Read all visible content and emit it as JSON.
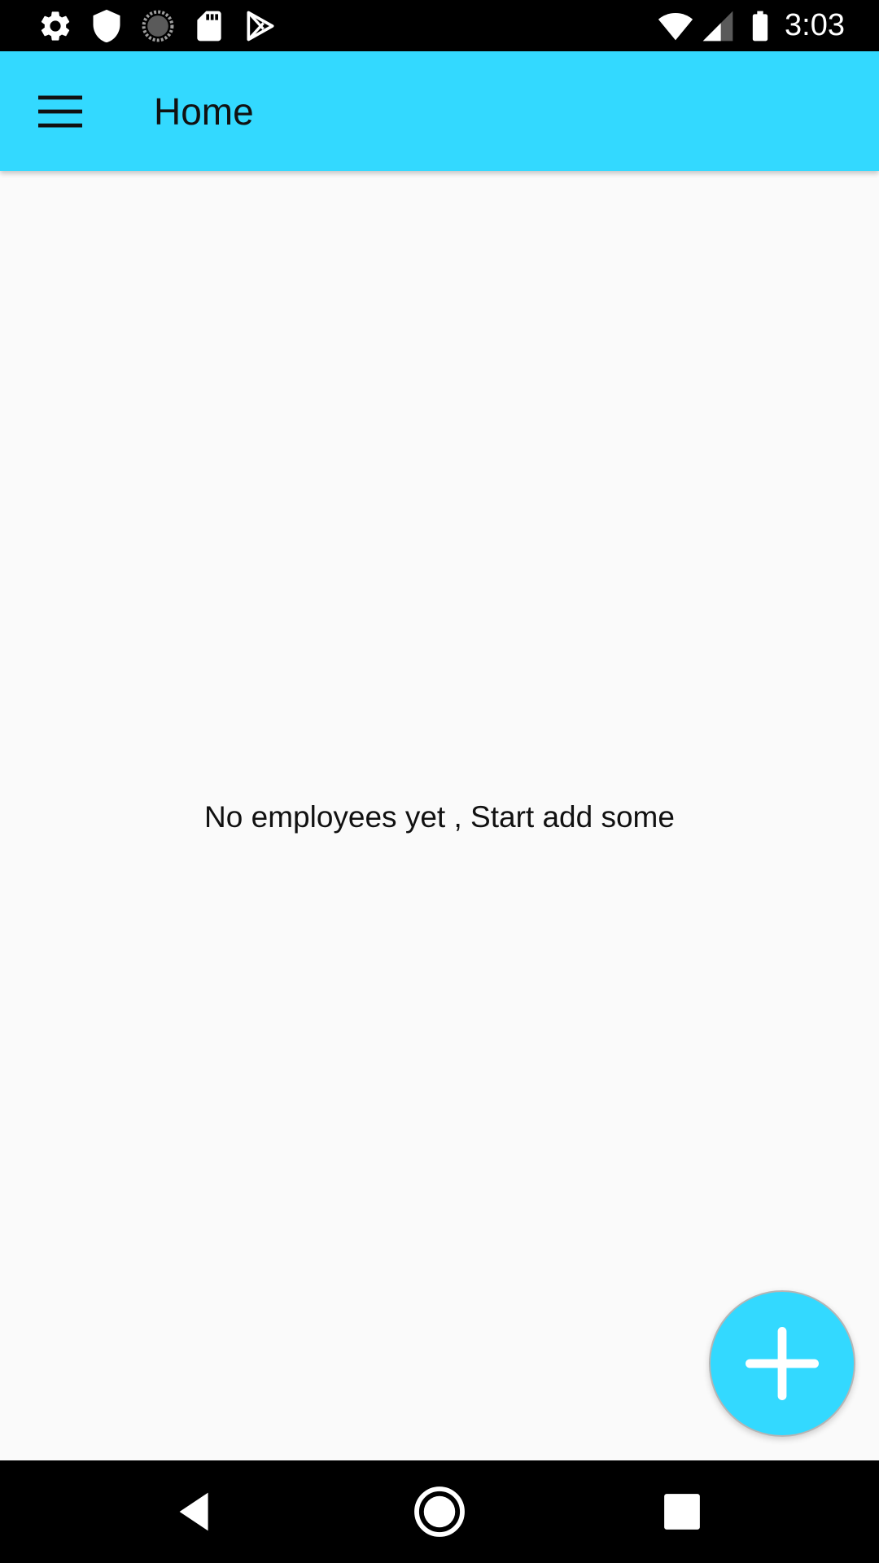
{
  "status_bar": {
    "time": "3:03",
    "left_icons": [
      "settings-icon",
      "shield-icon",
      "sync-icon",
      "sd-card-icon",
      "play-store-icon"
    ],
    "right_icons": [
      "wifi-icon",
      "cellular-signal-icon",
      "battery-icon"
    ]
  },
  "app_bar": {
    "title": "Home",
    "menu_icon": "hamburger-menu-icon",
    "color": "#33d9ff"
  },
  "main": {
    "empty_message": "No employees yet , Start add some"
  },
  "fab": {
    "icon": "plus-icon",
    "color": "#33d9ff"
  },
  "nav_bar": {
    "buttons": [
      "back-icon",
      "home-icon",
      "recents-icon"
    ]
  }
}
